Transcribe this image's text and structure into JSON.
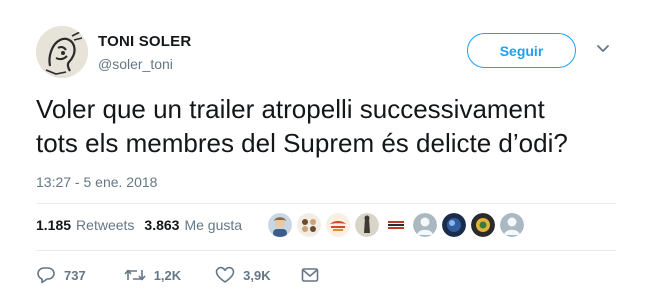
{
  "author": {
    "name": "TONI SOLER",
    "handle": "@soler_toni",
    "avatar_icon": "caricature-avatar"
  },
  "follow_button": {
    "label": "Seguir",
    "color": "#1da1f2"
  },
  "menu_icon": "chevron-down-icon",
  "tweet": {
    "line1": "Voler que un trailer atropelli successivament",
    "line2": "tots els membres del Suprem és delicte d’odi?",
    "timestamp": "13:27 - 5 ene. 2018"
  },
  "stats": {
    "retweets_count": "1.185",
    "retweets_label": "Retweets",
    "likes_count": "3.863",
    "likes_label": "Me gusta"
  },
  "likers": [
    "liker-avatar-1",
    "liker-avatar-2",
    "liker-avatar-3",
    "liker-avatar-4",
    "liker-avatar-5",
    "liker-avatar-6",
    "liker-avatar-7",
    "liker-avatar-8",
    "liker-avatar-9",
    "liker-avatar-10"
  ],
  "actions": {
    "reply_count": "737",
    "retweet_count": "1,2K",
    "like_count": "3,9K",
    "message_icon": "envelope-icon"
  },
  "colors": {
    "text": "#14171a",
    "secondary": "#657786",
    "accent": "#1da1f2",
    "divider": "#e6ecf0"
  }
}
